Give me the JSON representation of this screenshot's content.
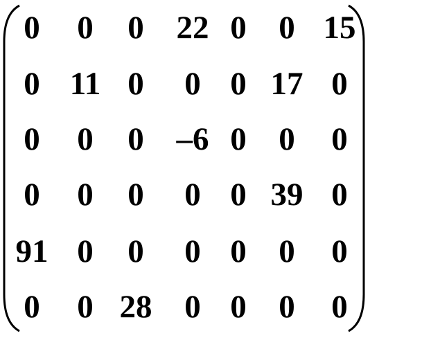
{
  "matrix": {
    "rows": [
      [
        "0",
        "0",
        "0",
        "22",
        "0",
        "0",
        "15"
      ],
      [
        "0",
        "11",
        "0",
        "0",
        "0",
        "17",
        "0"
      ],
      [
        "0",
        "0",
        "0",
        "–6",
        "0",
        "0",
        "0"
      ],
      [
        "0",
        "0",
        "0",
        "0",
        "0",
        "39",
        "0"
      ],
      [
        "91",
        "0",
        "0",
        "0",
        "0",
        "0",
        "0"
      ],
      [
        "0",
        "0",
        "28",
        "0",
        "0",
        "0",
        "0"
      ]
    ]
  },
  "colors": {
    "text": "#000000",
    "background": "#ffffff"
  }
}
